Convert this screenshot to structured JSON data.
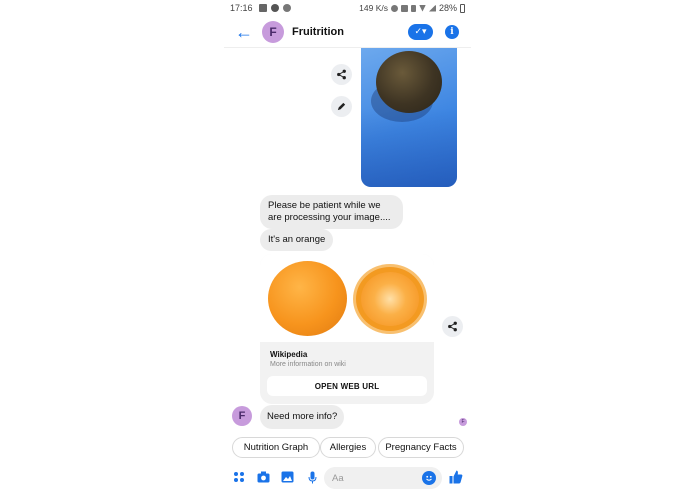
{
  "status_bar": {
    "time": "17:16",
    "network_speed": "149 K/s",
    "battery": "28%"
  },
  "header": {
    "avatar_letter": "F",
    "title": "Fruitrition",
    "check_icon": "check-icon",
    "info_icon": "info-icon"
  },
  "messages": [
    {
      "from": "bot",
      "text": "Please be patient while we are processing your image...."
    },
    {
      "from": "bot",
      "text": "It's an orange"
    }
  ],
  "card": {
    "source": "Wikipedia",
    "subtitle": "More information on wiki",
    "button_label": "OPEN WEB URL"
  },
  "follow_up": {
    "avatar_letter": "F",
    "text": "Need more info?"
  },
  "seen_indicator": "F",
  "quick_replies": [
    "Nutrition Graph",
    "Allergies",
    "Pregnancy Facts"
  ],
  "composer": {
    "placeholder": "Aa"
  },
  "colors": {
    "accent": "#1a73e8",
    "avatar": "#c79bdc",
    "bubble": "#ececec"
  }
}
